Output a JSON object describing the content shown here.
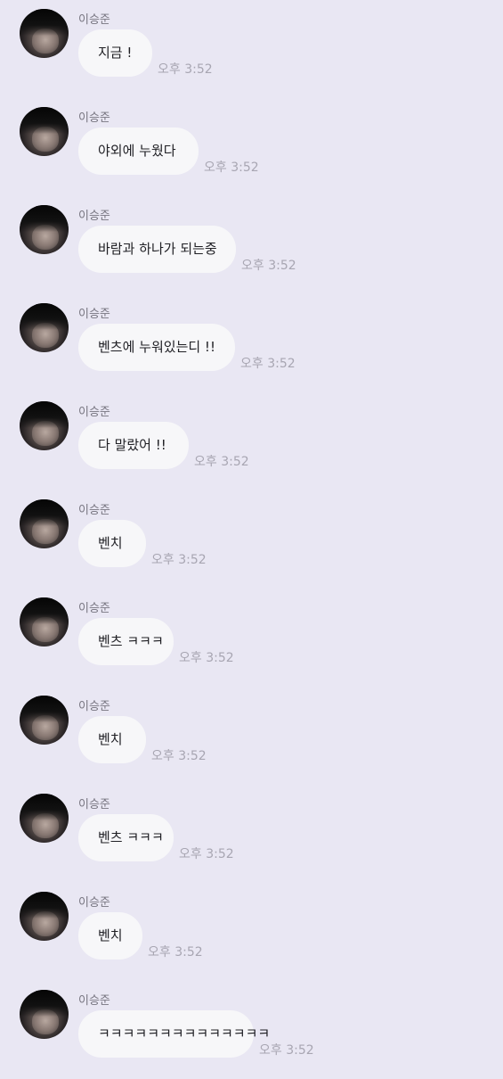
{
  "sender": "이승준",
  "messages": [
    {
      "text": "지금 !",
      "time": "오후 3:52"
    },
    {
      "text": "야외에 누웠다",
      "time": "오후 3:52"
    },
    {
      "text": "바람과 하나가 되는중",
      "time": "오후 3:52"
    },
    {
      "text": "벤츠에 누워있는디 !!",
      "time": "오후 3:52"
    },
    {
      "text": "다 말랐어 !!",
      "time": "오후 3:52"
    },
    {
      "text": "벤치",
      "time": "오후 3:52"
    },
    {
      "text": "벤츠 ㅋㅋㅋ",
      "time": "오후 3:52"
    },
    {
      "text": "벤치",
      "time": "오후 3:52"
    },
    {
      "text": "벤츠 ㅋㅋㅋ",
      "time": "오후 3:52"
    },
    {
      "text": "벤치",
      "time": "오후 3:52"
    },
    {
      "text": "ㅋㅋㅋㅋㅋㅋㅋㅋㅋㅋㅋㅋㅋㅋ",
      "time": "오후 3:52"
    }
  ],
  "colors": {
    "background": "#e9e7f3",
    "bubble": "#f7f7f9",
    "timestamp": "#a8a6b2",
    "name": "#777580"
  },
  "icons": {
    "avatar": "profile-photo"
  }
}
